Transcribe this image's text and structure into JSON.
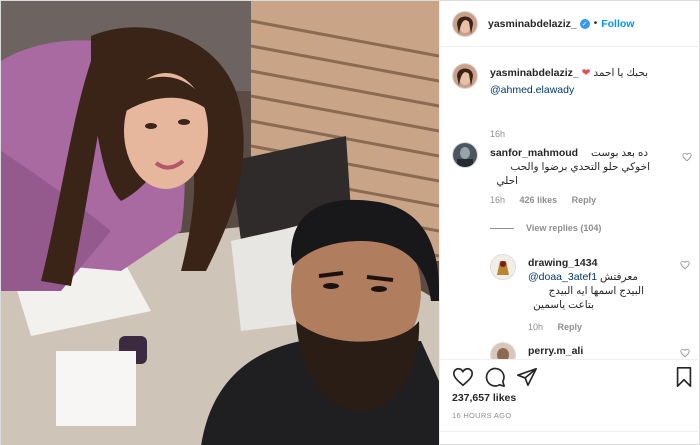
{
  "post": {
    "username": "yasminabdelaziz_",
    "follow_label": "Follow",
    "separator": "•",
    "verified_mark": "✓"
  },
  "caption": {
    "username": "yasminabdelaziz_",
    "heart": "❤",
    "text": "بحبك يا احمد",
    "mention": "@ahmed.elawady",
    "time": "16h"
  },
  "comments": [
    {
      "username": "sanfor_mahmoud",
      "text_line1": "ده بعد بوست",
      "text_line2": "اخوكي حلو التحدي برضوا والحب",
      "text_line3": "احلي",
      "time": "16h",
      "likes": "426 likes",
      "reply": "Reply",
      "view_replies": "View replies (104)"
    },
    {
      "username": "drawing_1434",
      "mention": "@doaa_3atef1",
      "text_prefix": "معرفتش",
      "text_line2": "البيدج اسمها ايه البيدج",
      "text_line3": "بتاعت ياسمين",
      "time": "10h",
      "reply": "Reply"
    },
    {
      "username": "perry.m_ali"
    }
  ],
  "stats": {
    "likes": "237,657 likes",
    "timestamp": "16 HOURS AGO"
  },
  "icons": {
    "like": "heart-icon",
    "comment": "comment-icon",
    "share": "share-icon",
    "save": "bookmark-icon",
    "verified": "verified-badge-icon"
  },
  "colors": {
    "accent": "#0095f6",
    "verified": "#3897f0",
    "heart": "#ed4956",
    "muted": "#8e8e8e"
  }
}
